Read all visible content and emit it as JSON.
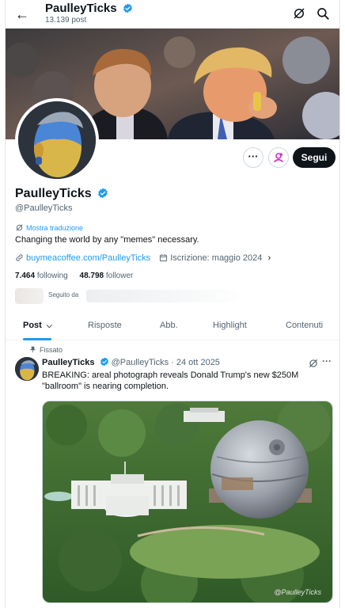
{
  "header": {
    "name": "PaulleyTicks",
    "post_count": "13.139 post",
    "back_icon": "arrow-left-icon",
    "grok_icon": "grok-icon",
    "search_icon": "search-icon"
  },
  "profile": {
    "name": "PaulleyTicks",
    "handle": "@PaulleyTicks",
    "translate_label": "Mostra traduzione",
    "bio": "Changing the world by any \"memes\" necessary.",
    "website": "buymeacoffee.com/PaulleyTicks",
    "joined": "Iscrizione: maggio 2024",
    "following_count": "7.464",
    "following_label": "following",
    "followers_count": "48.798",
    "followers_label": "follower",
    "followed_by_label": "Seguito da",
    "follow_button": "Segui",
    "more_button": "···"
  },
  "tabs": [
    {
      "label": "Post",
      "active": true
    },
    {
      "label": "Risposte",
      "active": false
    },
    {
      "label": "Abb.",
      "active": false
    },
    {
      "label": "Highlight",
      "active": false
    },
    {
      "label": "Contenuti",
      "active": false
    }
  ],
  "pinned_tweet": {
    "pinned_label": "Fissato",
    "author_name": "PaulleyTicks",
    "author_handle": "@PaulleyTicks",
    "separator": "·",
    "date": "24 ott 2025",
    "more_button": "···",
    "text": "BREAKING: areal photograph reveals Donald Trump's new $250M \"ballroom\" is nearing completion.",
    "image_watermark": "@PaulleyTicks"
  },
  "colors": {
    "accent": "#1d9bf0",
    "verified": "#1d9bf0",
    "follow_button_bg": "#0f1419",
    "text_primary": "#0f1419",
    "text_secondary": "#536471"
  }
}
